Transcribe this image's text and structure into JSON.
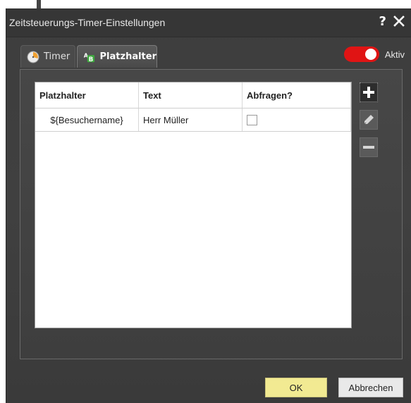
{
  "window": {
    "title": "Zeitsteuerungs-Timer-Einstellungen",
    "help_label": "?",
    "close_icon": "close-icon"
  },
  "tabs": [
    {
      "label": "Timer",
      "icon": "clock-icon",
      "selected": false
    },
    {
      "label": "Platzhalter",
      "icon": "placeholder-ab-icon",
      "selected": true
    }
  ],
  "toggle": {
    "label": "Aktiv",
    "on": true,
    "color": "#e01414"
  },
  "table": {
    "columns": [
      "Platzhalter",
      "Text",
      "Abfragen?"
    ],
    "rows": [
      {
        "placeholder": "${Besuchername}",
        "text": "Herr Müller",
        "query": false
      }
    ]
  },
  "side_buttons": [
    {
      "icon": "plus-icon",
      "state": "active"
    },
    {
      "icon": "pencil-icon",
      "state": "disabled"
    },
    {
      "icon": "minus-icon",
      "state": "disabled"
    }
  ],
  "footer": {
    "ok_label": "OK",
    "cancel_label": "Abbrechen",
    "ok_color": "#f2ea92"
  }
}
